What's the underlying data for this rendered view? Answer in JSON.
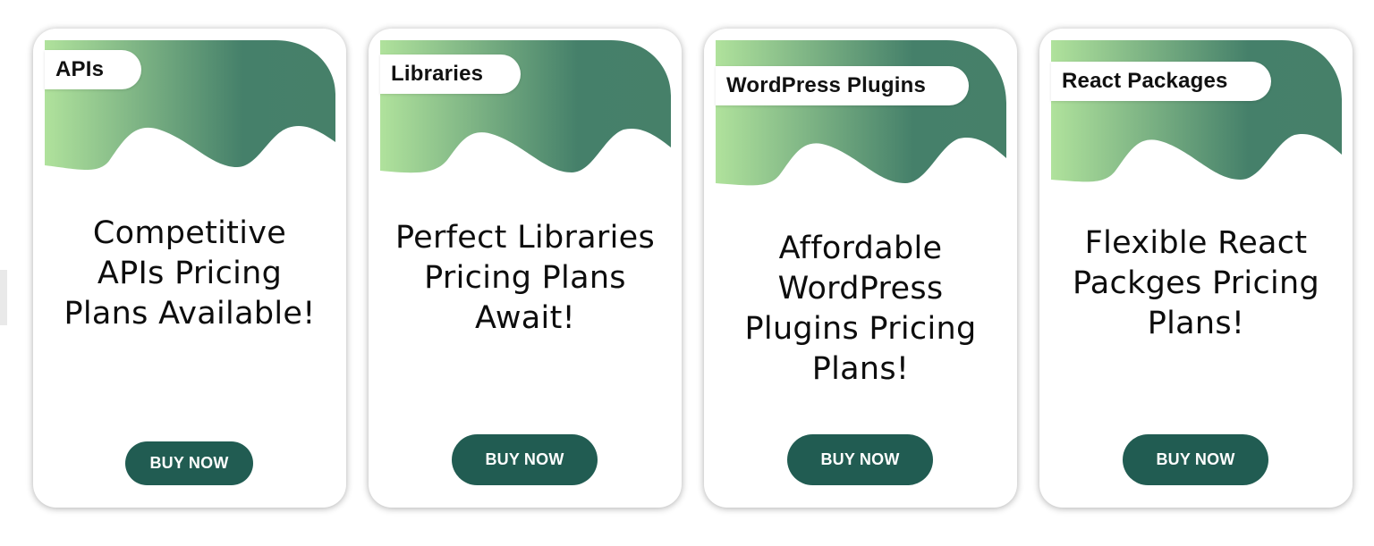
{
  "cards": [
    {
      "tag": "APIs",
      "headline": "Competitive APIs Pricing Plans Available!",
      "button": "BUY NOW"
    },
    {
      "tag": "Libraries",
      "headline": "Perfect Libraries Pricing Plans Await!",
      "button": "BUY NOW"
    },
    {
      "tag": "WordPress Plugins",
      "headline": "Affordable WordPress Plugins Pricing Plans!",
      "button": "BUY NOW"
    },
    {
      "tag": "React Packages",
      "headline": "Flexible React Packges Pricing Plans!",
      "button": "BUY NOW"
    }
  ],
  "colors": {
    "wave_light": "#b0e29c",
    "wave_dark": "#45806a",
    "button_bg": "#215c52",
    "button_text": "#ffffff"
  }
}
